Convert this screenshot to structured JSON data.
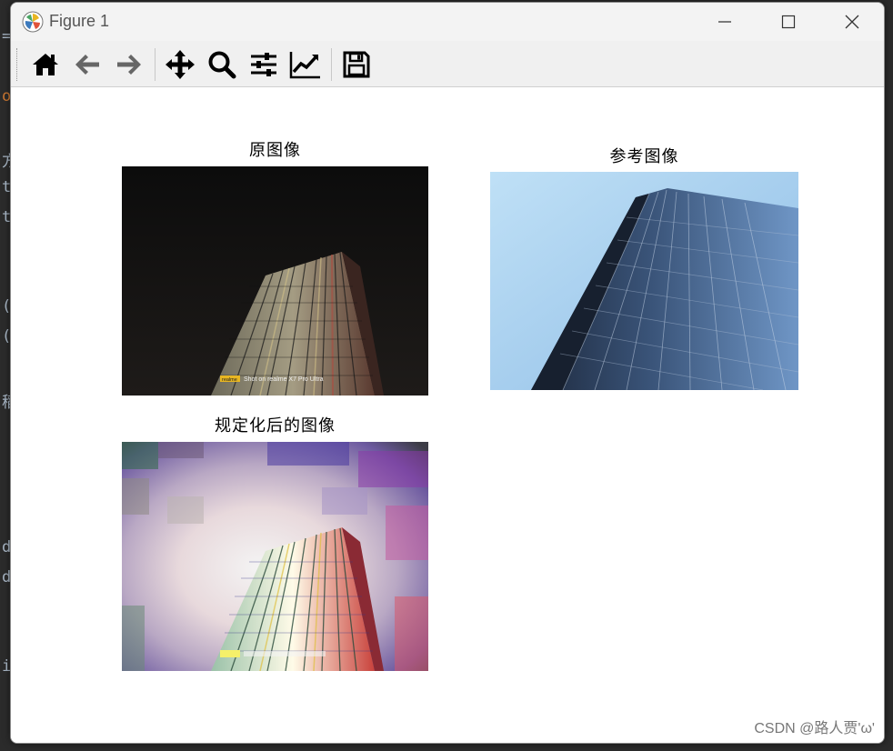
{
  "window": {
    "title": "Figure 1"
  },
  "toolbar": {
    "buttons": [
      {
        "name": "home-icon"
      },
      {
        "name": "back-arrow-icon"
      },
      {
        "name": "forward-arrow-icon"
      },
      {
        "name": "pan-move-icon"
      },
      {
        "name": "zoom-magnifier-icon"
      },
      {
        "name": "configure-subplots-icon"
      },
      {
        "name": "edit-axis-line-icon"
      },
      {
        "name": "save-floppy-icon"
      }
    ]
  },
  "figure": {
    "subplots": [
      {
        "title": "原图像",
        "caption": "Shot on realme X7 Pro Ultra",
        "badge": "realme"
      },
      {
        "title": "参考图像"
      },
      {
        "title": "规定化后的图像"
      }
    ]
  },
  "watermark": "CSDN @路人贾'ω'",
  "colors": {
    "night_sky": "#111111",
    "day_sky": "#9cc8ec",
    "badge": "#e8b622"
  }
}
